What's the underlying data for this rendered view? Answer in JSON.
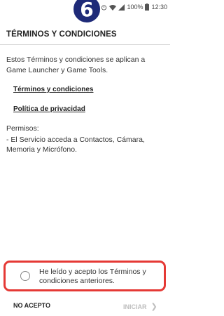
{
  "status_bar": {
    "battery": "100%",
    "time": "12:30"
  },
  "step_badge": "6",
  "title": "TÉRMINOS Y CONDICIONES",
  "intro": "Estos Términos y condiciones se aplican a Game Launcher y Game Tools.",
  "links": {
    "terms": "Términos y condiciones",
    "privacy": "Política de privacidad"
  },
  "permissions": {
    "title": "Permisos:",
    "text": "- El Servicio acceda a Contactos, Cámara, Memoria y Micrófono."
  },
  "consent": {
    "label": "He leído y acepto los Términos y condiciones anteriores.",
    "checked": false,
    "highlight_color": "#e53935"
  },
  "buttons": {
    "decline": "NO ACEPTO",
    "start": "INICIAR"
  },
  "colors": {
    "badge": "#1e2a78",
    "disabled": "#bdbdbd"
  }
}
